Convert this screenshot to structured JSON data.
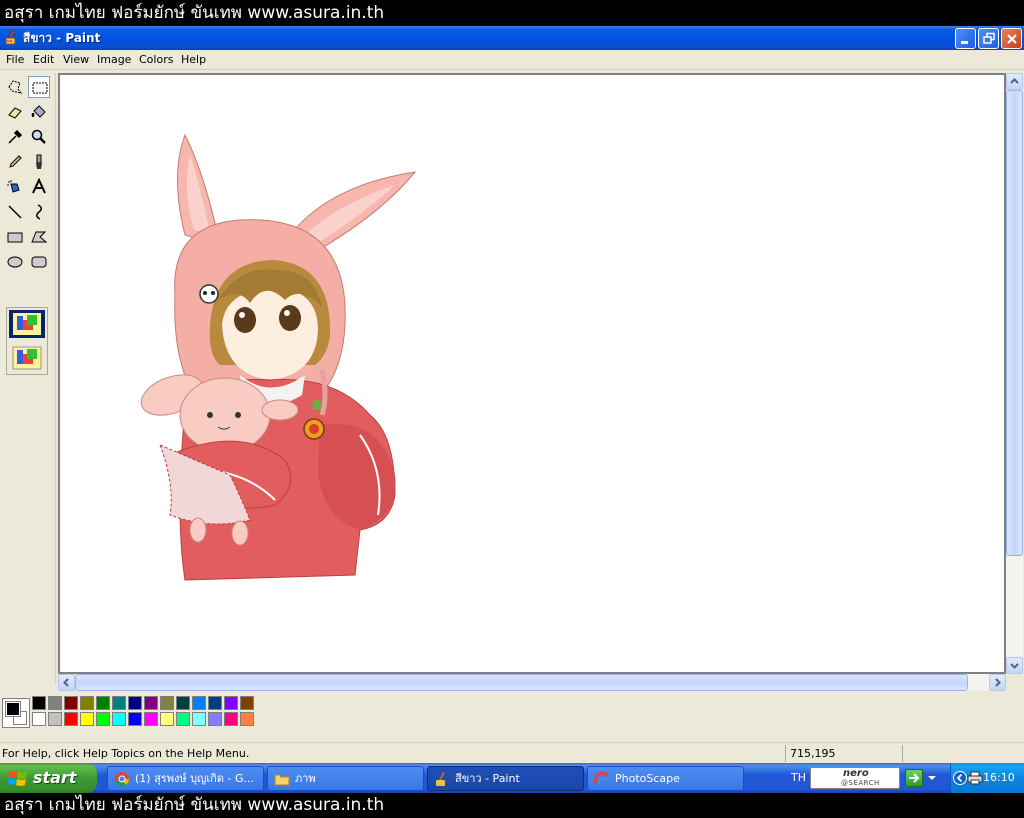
{
  "banner": {
    "text": "อสุรา เกมไทย ฟอร์มยักษ์ ขันเทพ www.asura.in.th"
  },
  "window": {
    "title": "สีขาว - Paint"
  },
  "menu": {
    "items": [
      "File",
      "Edit",
      "View",
      "Image",
      "Colors",
      "Help"
    ]
  },
  "tools": [
    "free-form-select",
    "select",
    "eraser",
    "fill-with-color",
    "pick-color",
    "magnifier",
    "pencil",
    "brush",
    "airbrush",
    "text",
    "line",
    "curve",
    "rectangle",
    "polygon",
    "ellipse",
    "rounded-rectangle"
  ],
  "canvas": {
    "image": "anime girl in pink bunny hood hugging plush bunny"
  },
  "palette": {
    "foreground": "#000000",
    "background": "#ffffff",
    "top_row": [
      "#000000",
      "#808080",
      "#800000",
      "#808000",
      "#008000",
      "#008080",
      "#000080",
      "#800080",
      "#808040",
      "#004040",
      "#0080ff",
      "#004080",
      "#8000ff",
      "#804000"
    ],
    "bottom_row": [
      "#ffffff",
      "#c0c0c0",
      "#ff0000",
      "#ffff00",
      "#00ff00",
      "#00ffff",
      "#0000ff",
      "#ff00ff",
      "#ffff80",
      "#00ff80",
      "#80ffff",
      "#8080ff",
      "#ff0080",
      "#ff8040"
    ]
  },
  "status": {
    "help_text": "For Help, click Help Topics on the Help Menu.",
    "coords": "715,195"
  },
  "taskbar": {
    "start_label": "start",
    "tasks": [
      {
        "label": "(1) สุรพงษ์ บุญเกิด - G...",
        "icon": "chrome-icon"
      },
      {
        "label": "ภาพ",
        "icon": "folder-icon"
      },
      {
        "label": "สีขาว - Paint",
        "icon": "paint-icon"
      },
      {
        "label": "PhotoScape",
        "icon": "photoscape-icon"
      }
    ],
    "language": "TH",
    "nero_brand": "nero",
    "nero_sub": "@SEARCH",
    "clock": "16:10"
  }
}
